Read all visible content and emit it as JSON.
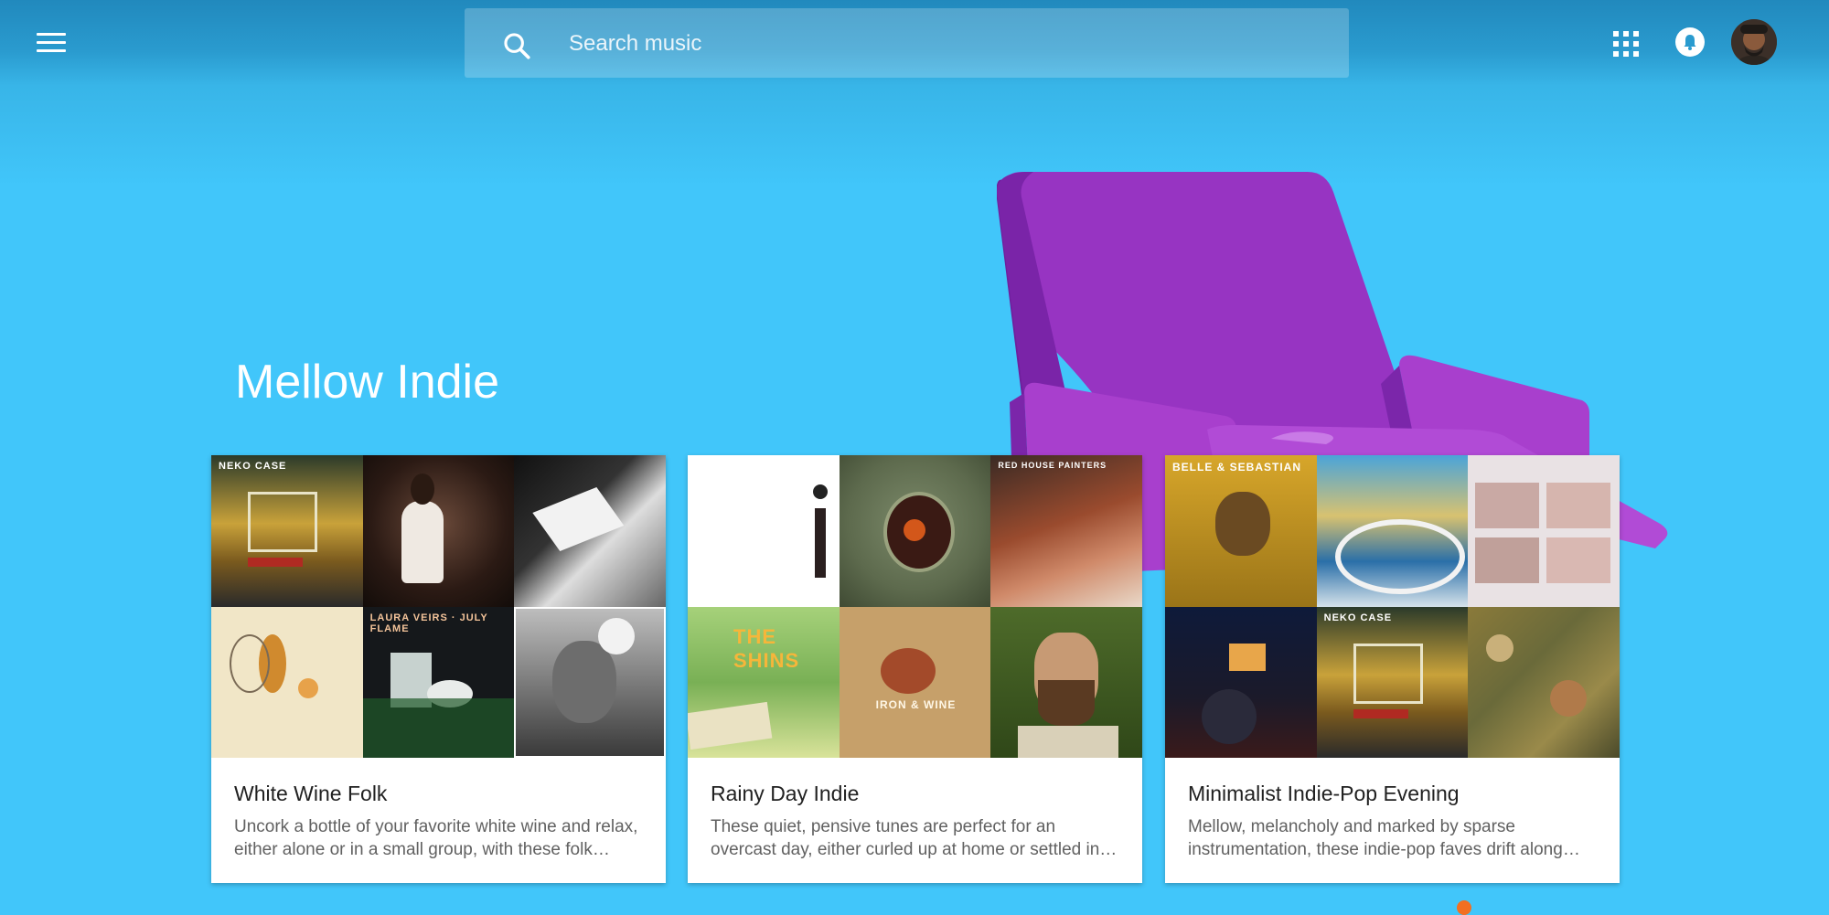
{
  "search": {
    "placeholder": "Search music"
  },
  "section": {
    "title": "Mellow Indie"
  },
  "cards": [
    {
      "title": "White Wine Folk",
      "description": "Uncork a bottle of your favorite white wine and relax, either alone or in a small group, with these folk favorites.",
      "cover_labels": [
        "NEKO CASE",
        "",
        "",
        "",
        "LAURA VEIRS · JULY FLAME",
        ""
      ]
    },
    {
      "title": "Rainy Day Indie",
      "description": "These quiet, pensive tunes are perfect for an overcast day, either curled up at home or settled in somewhere cozy.",
      "cover_labels": [
        "",
        "",
        "RED HOUSE PAINTERS",
        "THE SHINS",
        "IRON & WINE",
        ""
      ]
    },
    {
      "title": "Minimalist Indie-Pop Evening",
      "description": "Mellow, melancholy and marked by sparse instrumentation, these indie-pop faves drift along softly through the evening.",
      "cover_labels": [
        "BELLE & SEBASTIAN",
        "",
        "",
        "",
        "NEKO CASE",
        ""
      ]
    }
  ],
  "colors": {
    "background": "#41c6fa",
    "chair": "#8e2fb8",
    "accent_dot": "#f26f21"
  }
}
